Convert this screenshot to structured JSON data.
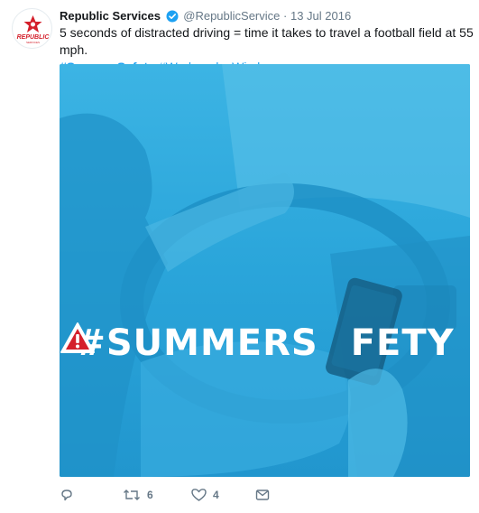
{
  "tweet": {
    "author_name": "Republic Services",
    "handle": "@RepublicService",
    "separator": "·",
    "date": "13 Jul 2016",
    "text_line1": "5 seconds of distracted driving = time it takes to travel a football field at 55 mph.",
    "hashtag1": "#SummerSafety",
    "hashtag2": "#WednesdayWisdom",
    "avatar_logo_text": "REPUBLIC",
    "avatar_logo_subtext": "SERVICES"
  },
  "media": {
    "overlay_text_before": "#SUMMERS",
    "overlay_text_after": "FETY",
    "tint_color": "#2aa8dc"
  },
  "actions": {
    "reply_count": "",
    "retweet_count": "6",
    "like_count": "4"
  },
  "colors": {
    "brand_red": "#d4202b",
    "link_blue": "#1da1f2",
    "muted_gray": "#657786"
  },
  "icons": [
    "verified-badge-icon",
    "reply-icon",
    "retweet-icon",
    "like-icon",
    "direct-message-icon",
    "warning-triangle-icon"
  ]
}
